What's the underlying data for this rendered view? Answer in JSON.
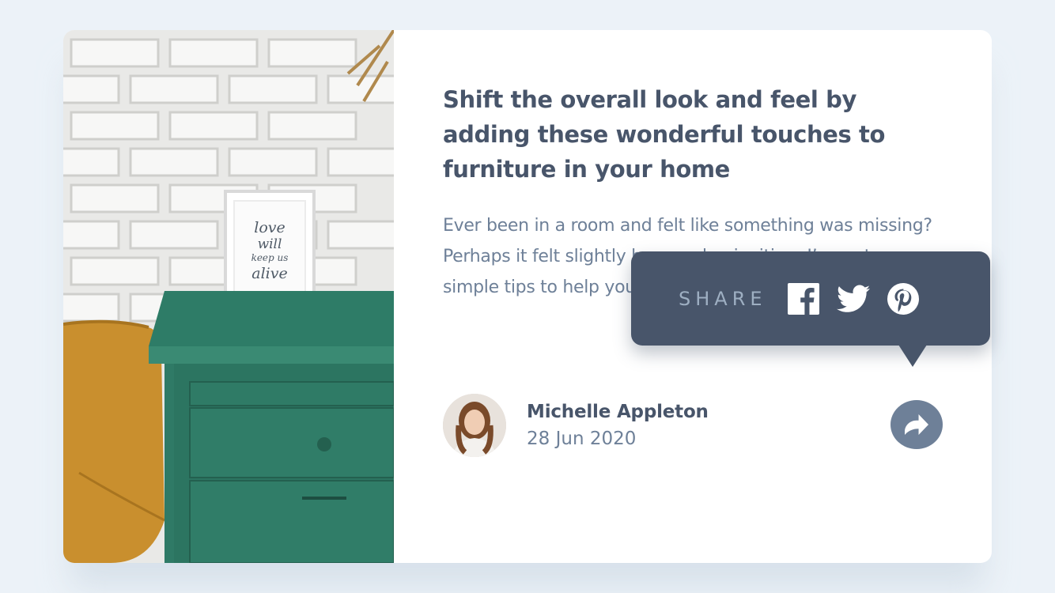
{
  "article": {
    "headline": "Shift the overall look and feel by adding these wonderful touches to furniture in your home",
    "description": "Ever been in a room and felt like something was missing? Perhaps it felt slightly bare and uninviting. I’ve got some simple tips to help you make any room feel complete.",
    "frame_text": "love will keep us alive"
  },
  "author": {
    "name": "Michelle Appleton",
    "date": "28 Jun 2020"
  },
  "share": {
    "label": "SHARE",
    "icons": [
      "facebook-icon",
      "twitter-icon",
      "pinterest-icon"
    ],
    "button_icon": "share-arrow-icon"
  },
  "colors": {
    "background": "#ecf2f8",
    "card": "#ffffff",
    "heading": "#48556a",
    "body_text": "#6e8098",
    "tooltip_bg": "#48556a",
    "tooltip_label": "#9eafc2",
    "share_button": "#6e8098"
  }
}
